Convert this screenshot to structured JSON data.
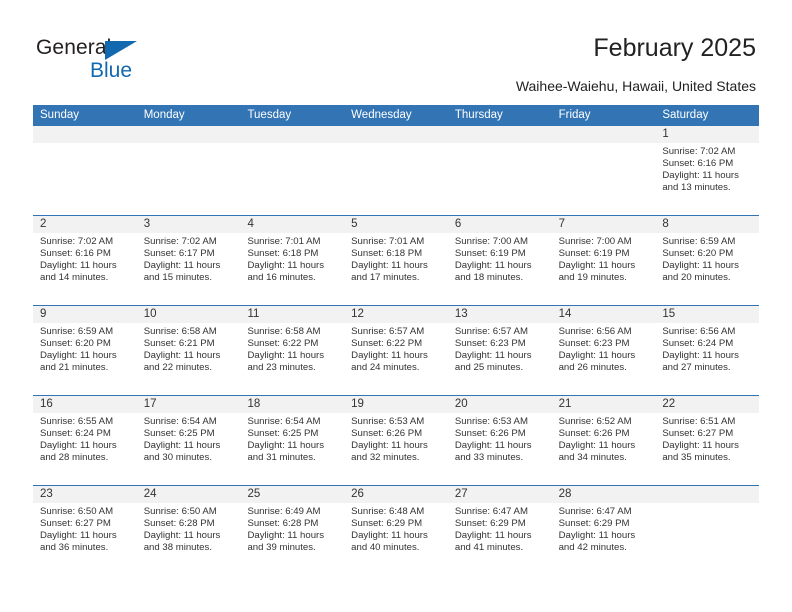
{
  "brand": {
    "name_part1": "General",
    "name_part2": "Blue",
    "accent_color": "#1269b0"
  },
  "header": {
    "title": "February 2025",
    "subtitle": "Waihee-Waiehu, Hawaii, United States"
  },
  "calendar": {
    "header_bg": "#3274b4",
    "weekdays": [
      "Sunday",
      "Monday",
      "Tuesday",
      "Wednesday",
      "Thursday",
      "Friday",
      "Saturday"
    ],
    "labels": {
      "sunrise": "Sunrise:",
      "sunset": "Sunset:",
      "daylight": "Daylight:"
    },
    "weeks": [
      [
        {
          "empty": true
        },
        {
          "empty": true
        },
        {
          "empty": true
        },
        {
          "empty": true
        },
        {
          "empty": true
        },
        {
          "empty": true
        },
        {
          "day": "1",
          "sunrise": "Sunrise: 7:02 AM",
          "sunset": "Sunset: 6:16 PM",
          "daylight": "Daylight: 11 hours and 13 minutes."
        }
      ],
      [
        {
          "day": "2",
          "sunrise": "Sunrise: 7:02 AM",
          "sunset": "Sunset: 6:16 PM",
          "daylight": "Daylight: 11 hours and 14 minutes."
        },
        {
          "day": "3",
          "sunrise": "Sunrise: 7:02 AM",
          "sunset": "Sunset: 6:17 PM",
          "daylight": "Daylight: 11 hours and 15 minutes."
        },
        {
          "day": "4",
          "sunrise": "Sunrise: 7:01 AM",
          "sunset": "Sunset: 6:18 PM",
          "daylight": "Daylight: 11 hours and 16 minutes."
        },
        {
          "day": "5",
          "sunrise": "Sunrise: 7:01 AM",
          "sunset": "Sunset: 6:18 PM",
          "daylight": "Daylight: 11 hours and 17 minutes."
        },
        {
          "day": "6",
          "sunrise": "Sunrise: 7:00 AM",
          "sunset": "Sunset: 6:19 PM",
          "daylight": "Daylight: 11 hours and 18 minutes."
        },
        {
          "day": "7",
          "sunrise": "Sunrise: 7:00 AM",
          "sunset": "Sunset: 6:19 PM",
          "daylight": "Daylight: 11 hours and 19 minutes."
        },
        {
          "day": "8",
          "sunrise": "Sunrise: 6:59 AM",
          "sunset": "Sunset: 6:20 PM",
          "daylight": "Daylight: 11 hours and 20 minutes."
        }
      ],
      [
        {
          "day": "9",
          "sunrise": "Sunrise: 6:59 AM",
          "sunset": "Sunset: 6:20 PM",
          "daylight": "Daylight: 11 hours and 21 minutes."
        },
        {
          "day": "10",
          "sunrise": "Sunrise: 6:58 AM",
          "sunset": "Sunset: 6:21 PM",
          "daylight": "Daylight: 11 hours and 22 minutes."
        },
        {
          "day": "11",
          "sunrise": "Sunrise: 6:58 AM",
          "sunset": "Sunset: 6:22 PM",
          "daylight": "Daylight: 11 hours and 23 minutes."
        },
        {
          "day": "12",
          "sunrise": "Sunrise: 6:57 AM",
          "sunset": "Sunset: 6:22 PM",
          "daylight": "Daylight: 11 hours and 24 minutes."
        },
        {
          "day": "13",
          "sunrise": "Sunrise: 6:57 AM",
          "sunset": "Sunset: 6:23 PM",
          "daylight": "Daylight: 11 hours and 25 minutes."
        },
        {
          "day": "14",
          "sunrise": "Sunrise: 6:56 AM",
          "sunset": "Sunset: 6:23 PM",
          "daylight": "Daylight: 11 hours and 26 minutes."
        },
        {
          "day": "15",
          "sunrise": "Sunrise: 6:56 AM",
          "sunset": "Sunset: 6:24 PM",
          "daylight": "Daylight: 11 hours and 27 minutes."
        }
      ],
      [
        {
          "day": "16",
          "sunrise": "Sunrise: 6:55 AM",
          "sunset": "Sunset: 6:24 PM",
          "daylight": "Daylight: 11 hours and 28 minutes."
        },
        {
          "day": "17",
          "sunrise": "Sunrise: 6:54 AM",
          "sunset": "Sunset: 6:25 PM",
          "daylight": "Daylight: 11 hours and 30 minutes."
        },
        {
          "day": "18",
          "sunrise": "Sunrise: 6:54 AM",
          "sunset": "Sunset: 6:25 PM",
          "daylight": "Daylight: 11 hours and 31 minutes."
        },
        {
          "day": "19",
          "sunrise": "Sunrise: 6:53 AM",
          "sunset": "Sunset: 6:26 PM",
          "daylight": "Daylight: 11 hours and 32 minutes."
        },
        {
          "day": "20",
          "sunrise": "Sunrise: 6:53 AM",
          "sunset": "Sunset: 6:26 PM",
          "daylight": "Daylight: 11 hours and 33 minutes."
        },
        {
          "day": "21",
          "sunrise": "Sunrise: 6:52 AM",
          "sunset": "Sunset: 6:26 PM",
          "daylight": "Daylight: 11 hours and 34 minutes."
        },
        {
          "day": "22",
          "sunrise": "Sunrise: 6:51 AM",
          "sunset": "Sunset: 6:27 PM",
          "daylight": "Daylight: 11 hours and 35 minutes."
        }
      ],
      [
        {
          "day": "23",
          "sunrise": "Sunrise: 6:50 AM",
          "sunset": "Sunset: 6:27 PM",
          "daylight": "Daylight: 11 hours and 36 minutes."
        },
        {
          "day": "24",
          "sunrise": "Sunrise: 6:50 AM",
          "sunset": "Sunset: 6:28 PM",
          "daylight": "Daylight: 11 hours and 38 minutes."
        },
        {
          "day": "25",
          "sunrise": "Sunrise: 6:49 AM",
          "sunset": "Sunset: 6:28 PM",
          "daylight": "Daylight: 11 hours and 39 minutes."
        },
        {
          "day": "26",
          "sunrise": "Sunrise: 6:48 AM",
          "sunset": "Sunset: 6:29 PM",
          "daylight": "Daylight: 11 hours and 40 minutes."
        },
        {
          "day": "27",
          "sunrise": "Sunrise: 6:47 AM",
          "sunset": "Sunset: 6:29 PM",
          "daylight": "Daylight: 11 hours and 41 minutes."
        },
        {
          "day": "28",
          "sunrise": "Sunrise: 6:47 AM",
          "sunset": "Sunset: 6:29 PM",
          "daylight": "Daylight: 11 hours and 42 minutes."
        },
        {
          "empty": true
        }
      ]
    ]
  }
}
